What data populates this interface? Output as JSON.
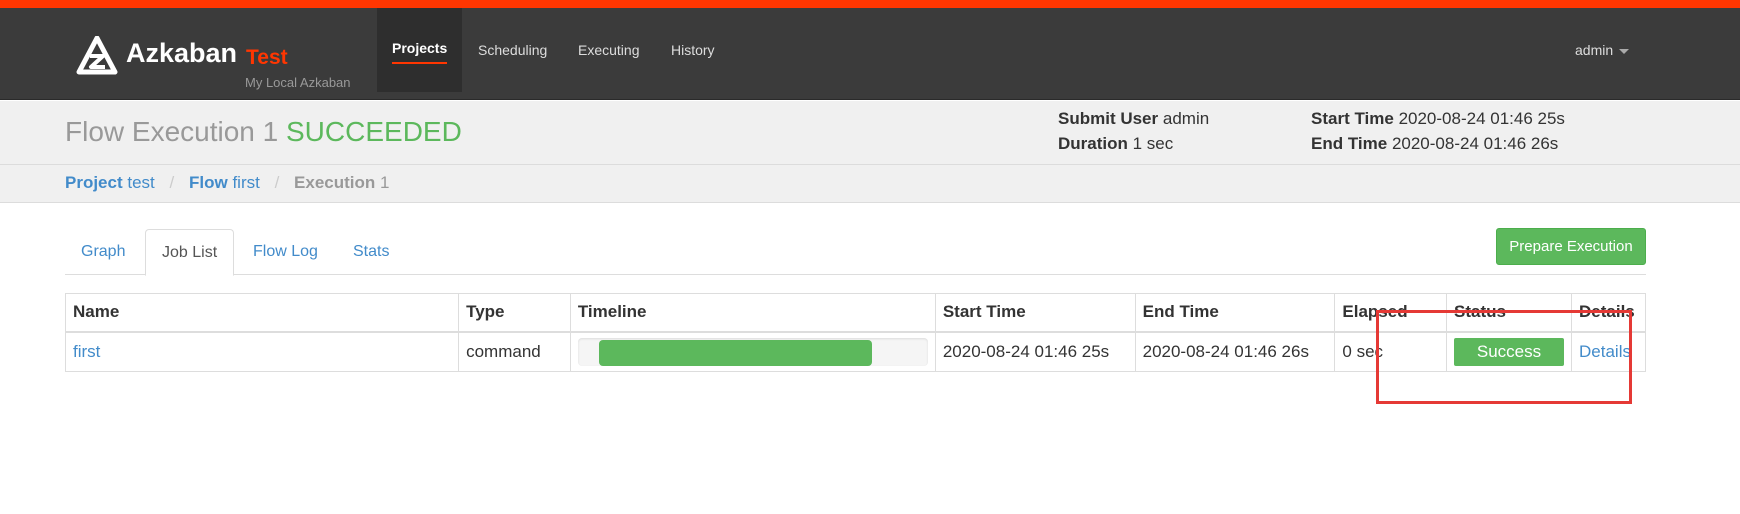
{
  "navbar": {
    "brand_name": "Azkaban",
    "brand_env": "Test",
    "brand_sub": "My Local Azkaban",
    "items": [
      {
        "label": "Projects",
        "active": true
      },
      {
        "label": "Scheduling",
        "active": false
      },
      {
        "label": "Executing",
        "active": false
      },
      {
        "label": "History",
        "active": false
      }
    ],
    "user": "admin"
  },
  "header": {
    "title_prefix": "Flow Execution 1",
    "title_status": "SUCCEEDED",
    "submit_user_label": "Submit User",
    "submit_user": "admin",
    "duration_label": "Duration",
    "duration": "1 sec",
    "start_time_label": "Start Time",
    "start_time": "2020-08-24 01:46 25s",
    "end_time_label": "End Time",
    "end_time": "2020-08-24 01:46 26s",
    "status_color": "#5cb85c"
  },
  "breadcrumb": {
    "project_label": "Project",
    "project": "test",
    "flow_label": "Flow",
    "flow": "first",
    "execution_label": "Execution",
    "execution": "1"
  },
  "tabs": [
    {
      "label": "Graph",
      "active": false
    },
    {
      "label": "Job List",
      "active": true
    },
    {
      "label": "Flow Log",
      "active": false
    },
    {
      "label": "Stats",
      "active": false
    }
  ],
  "prepare_button": "Prepare Execution",
  "table": {
    "headers": [
      "Name",
      "Type",
      "Timeline",
      "Start Time",
      "End Time",
      "Elapsed",
      "Status",
      "Details"
    ],
    "rows": [
      {
        "name": "first",
        "type": "command",
        "timeline_start_fraction": 0.06,
        "timeline_end_fraction": 0.84,
        "start_time": "2020-08-24 01:46 25s",
        "end_time": "2020-08-24 01:46 26s",
        "elapsed": "0 sec",
        "status": "Success",
        "details": "Details"
      }
    ]
  },
  "colors": {
    "accent": "#ff3601",
    "success": "#5cb85c",
    "link": "#428bca",
    "highlight": "#e53935"
  }
}
